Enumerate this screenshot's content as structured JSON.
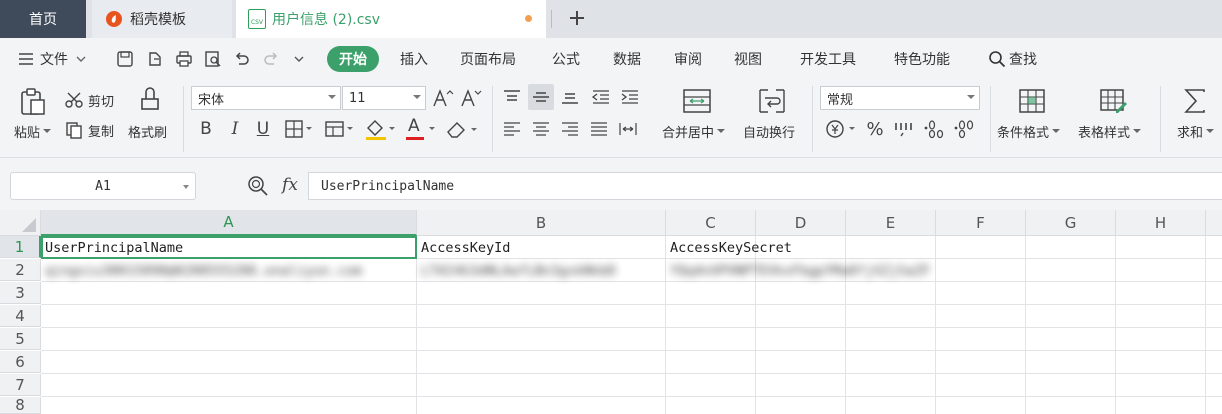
{
  "tabs": {
    "home": "首页",
    "docer": "稻壳模板",
    "file": "用户信息 (2).csv",
    "file_icon_text": "CSV"
  },
  "menu": {
    "file": "文件",
    "items": [
      "开始",
      "插入",
      "页面布局",
      "公式",
      "数据",
      "审阅",
      "视图",
      "开发工具",
      "特色功能"
    ],
    "search": "查找"
  },
  "ribbon": {
    "paste": "粘贴",
    "cut": "剪切",
    "copy": "复制",
    "format_painter": "格式刷",
    "font_name": "宋体",
    "font_size": "11",
    "bold": "B",
    "italic": "I",
    "underline": "U",
    "font_color_glyph": "A",
    "merge_center": "合并居中",
    "wrap_text": "自动换行",
    "number_format": "常规",
    "conditional_format": "条件格式",
    "table_style": "表格样式",
    "sum": "求和",
    "accent_color": "#3ba06a"
  },
  "formula_bar": {
    "cell_ref": "A1",
    "fx": "fx",
    "content": "UserPrincipalName"
  },
  "sheet": {
    "columns": [
      "A",
      "B",
      "C",
      "D",
      "E",
      "F",
      "G",
      "H"
    ],
    "rows": [
      "1",
      "2",
      "3",
      "4",
      "5",
      "6",
      "7",
      "8"
    ],
    "cells": {
      "A1": "UserPrincipalName",
      "B1": "AccessKeyId",
      "C1": "AccessKeySecret",
      "A2": "qingxiu38015898@0288555288.onaliyun.com",
      "B2": "LTAI4G3dNLAafLBn3gxkNkbD",
      "C2": "YQq4nXPVNPTEVkxFbgpYMa8fjXZjSaZF"
    }
  }
}
